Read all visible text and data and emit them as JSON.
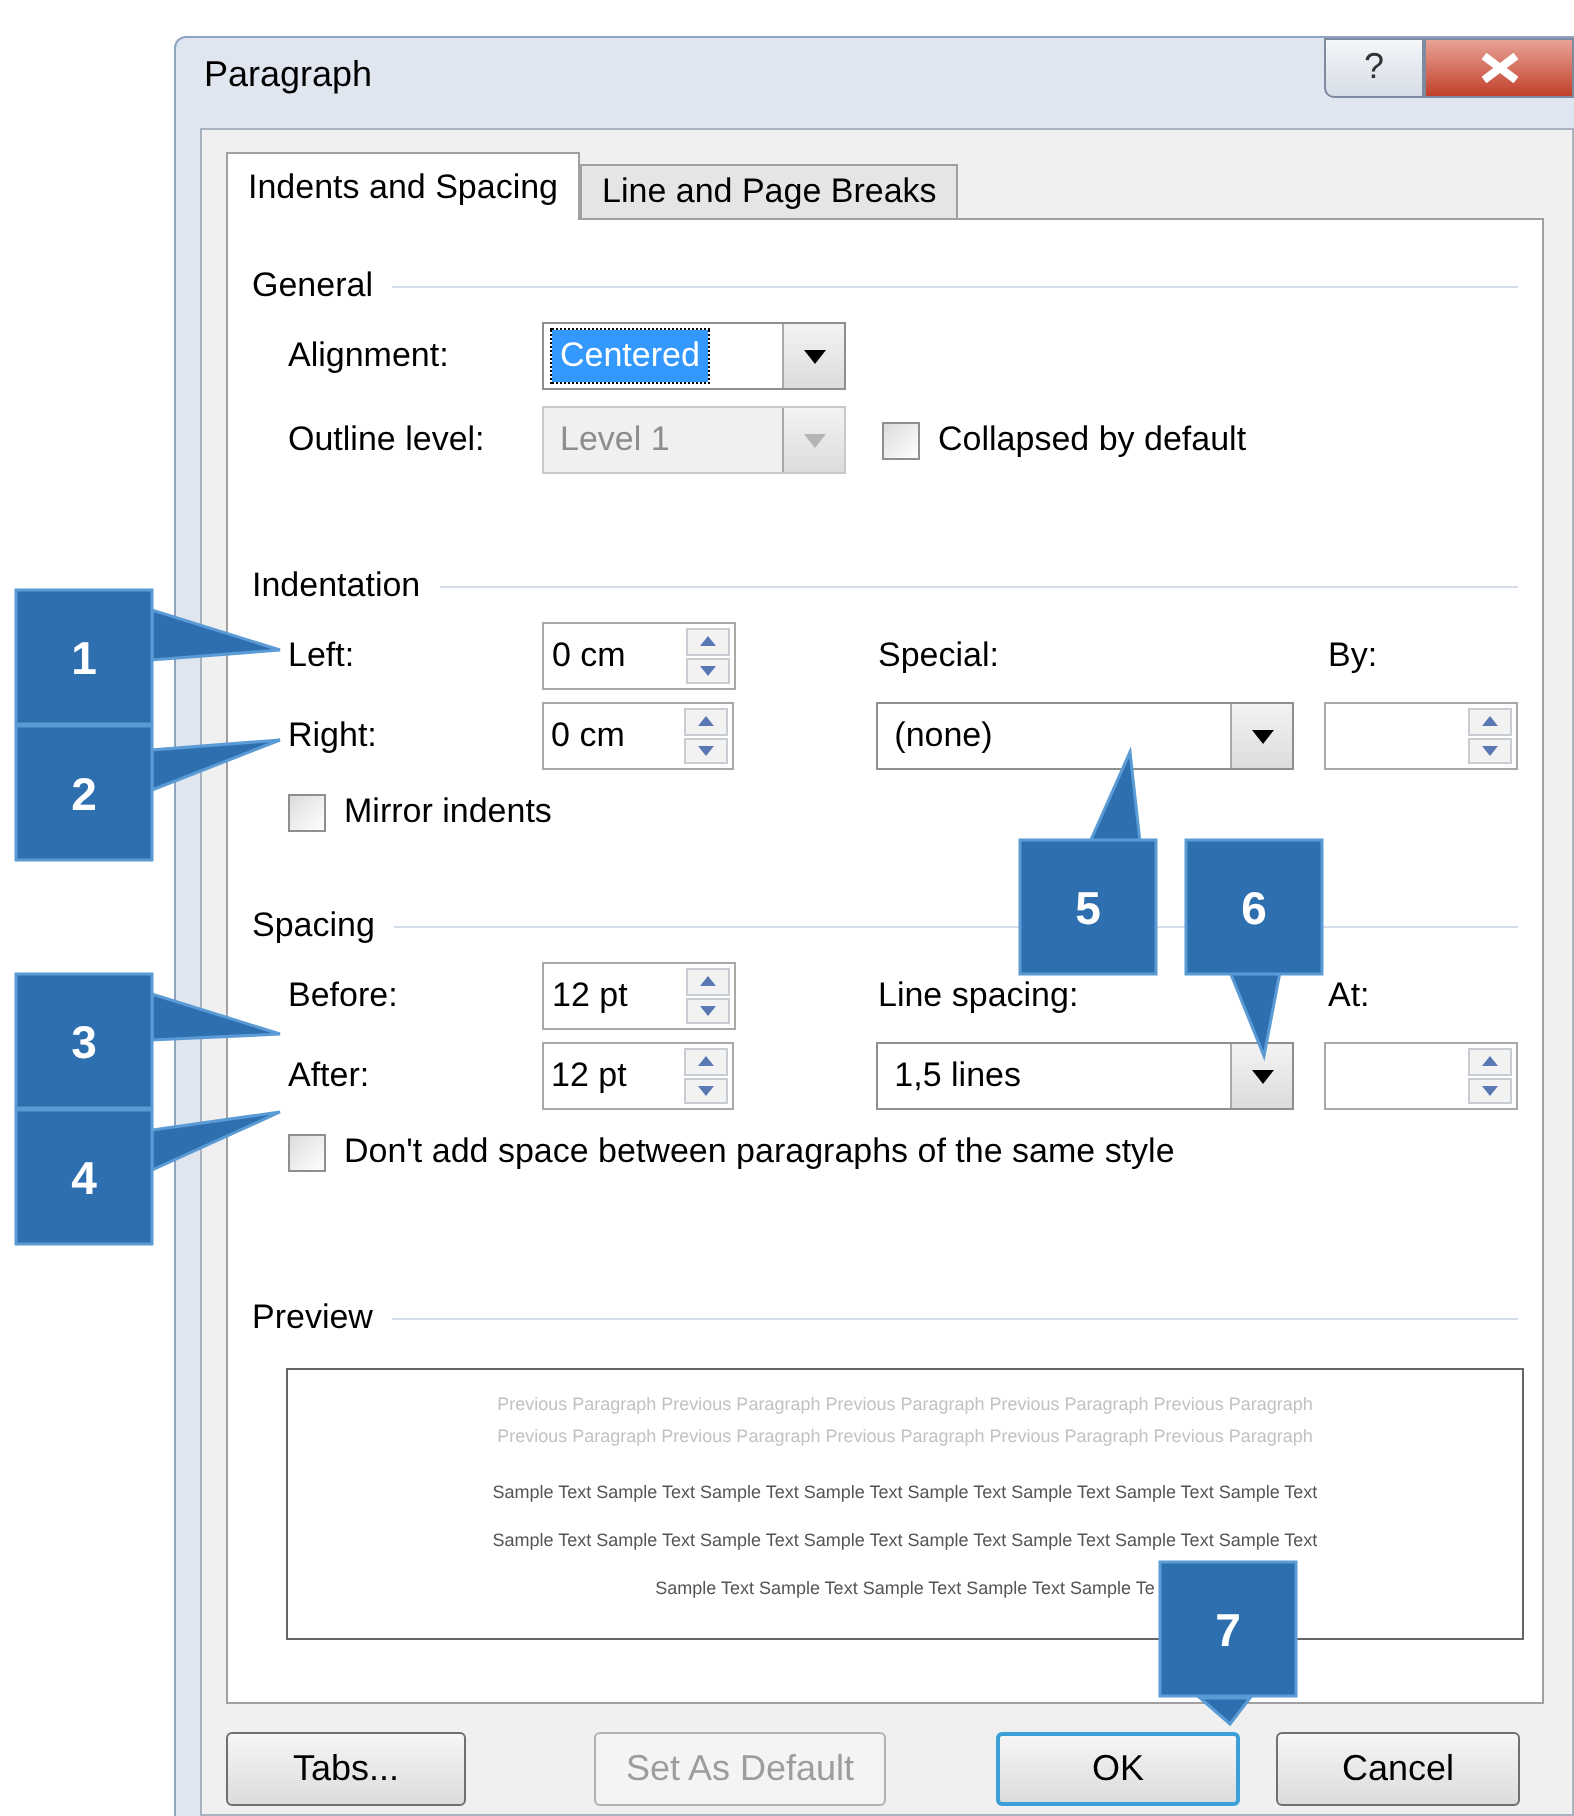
{
  "window": {
    "title": "Paragraph",
    "help_label": "?"
  },
  "tabs": [
    {
      "label": "Indents and Spacing",
      "selected": true
    },
    {
      "label": "Line and Page Breaks",
      "selected": false
    }
  ],
  "general": {
    "heading": "General",
    "fields": [
      {
        "kind": "dropdown",
        "label": "Alignment:",
        "value": "Centered",
        "focused": true,
        "disabled": false
      },
      {
        "kind": "dropdown",
        "label": "Outline level:",
        "value": "Level 1",
        "focused": false,
        "disabled": true
      }
    ],
    "checkbox": {
      "label": "Collapsed by default",
      "checked": false
    }
  },
  "indentation": {
    "heading": "Indentation",
    "left": {
      "kind": "spinner",
      "label": "Left:",
      "value": "0 cm"
    },
    "right": {
      "kind": "spinner",
      "label": "Right:",
      "value": "0 cm"
    },
    "special": {
      "kind": "dropdown",
      "label": "Special:",
      "value": "(none)",
      "focused": false,
      "disabled": false
    },
    "by": {
      "kind": "spinner",
      "label": "By:"
    },
    "checkbox": {
      "label": "Mirror indents",
      "checked": false
    }
  },
  "spacing": {
    "heading": "Spacing",
    "before": {
      "kind": "spinner",
      "label": "Before:",
      "value": "12 pt"
    },
    "after": {
      "kind": "spinner",
      "label": "After:",
      "value": "12 pt"
    },
    "line_spacing": {
      "kind": "dropdown",
      "label": "Line spacing:",
      "value": "1,5 lines",
      "focused": false,
      "disabled": false
    },
    "at": {
      "kind": "spinner",
      "label": "At:"
    },
    "checkbox": {
      "label": "Don't add space between paragraphs of the same style",
      "checked": false
    }
  },
  "preview": {
    "heading": "Preview",
    "previous_lines": [
      "Previous Paragraph Previous Paragraph Previous Paragraph Previous Paragraph Previous Paragraph",
      "Previous Paragraph Previous Paragraph Previous Paragraph Previous Paragraph Previous Paragraph"
    ],
    "sample_lines": [
      "Sample Text Sample Text Sample Text Sample Text Sample Text Sample Text Sample Text Sample Text",
      "Sample Text Sample Text Sample Text Sample Text Sample Text Sample Text Sample Text Sample Text",
      "Sample Text Sample Text Sample Text Sample Text Sample Te"
    ]
  },
  "buttons": [
    {
      "label": "Tabs...",
      "disabled": false,
      "default": false
    },
    {
      "label": "Set As Default",
      "disabled": true,
      "default": false
    },
    {
      "label": "OK",
      "disabled": false,
      "default": true
    },
    {
      "label": "Cancel",
      "disabled": false,
      "default": false
    }
  ],
  "callouts": [
    {
      "label": "1"
    },
    {
      "label": "2"
    },
    {
      "label": "3"
    },
    {
      "label": "4"
    },
    {
      "label": "5"
    },
    {
      "label": "6"
    },
    {
      "label": "7"
    }
  ]
}
